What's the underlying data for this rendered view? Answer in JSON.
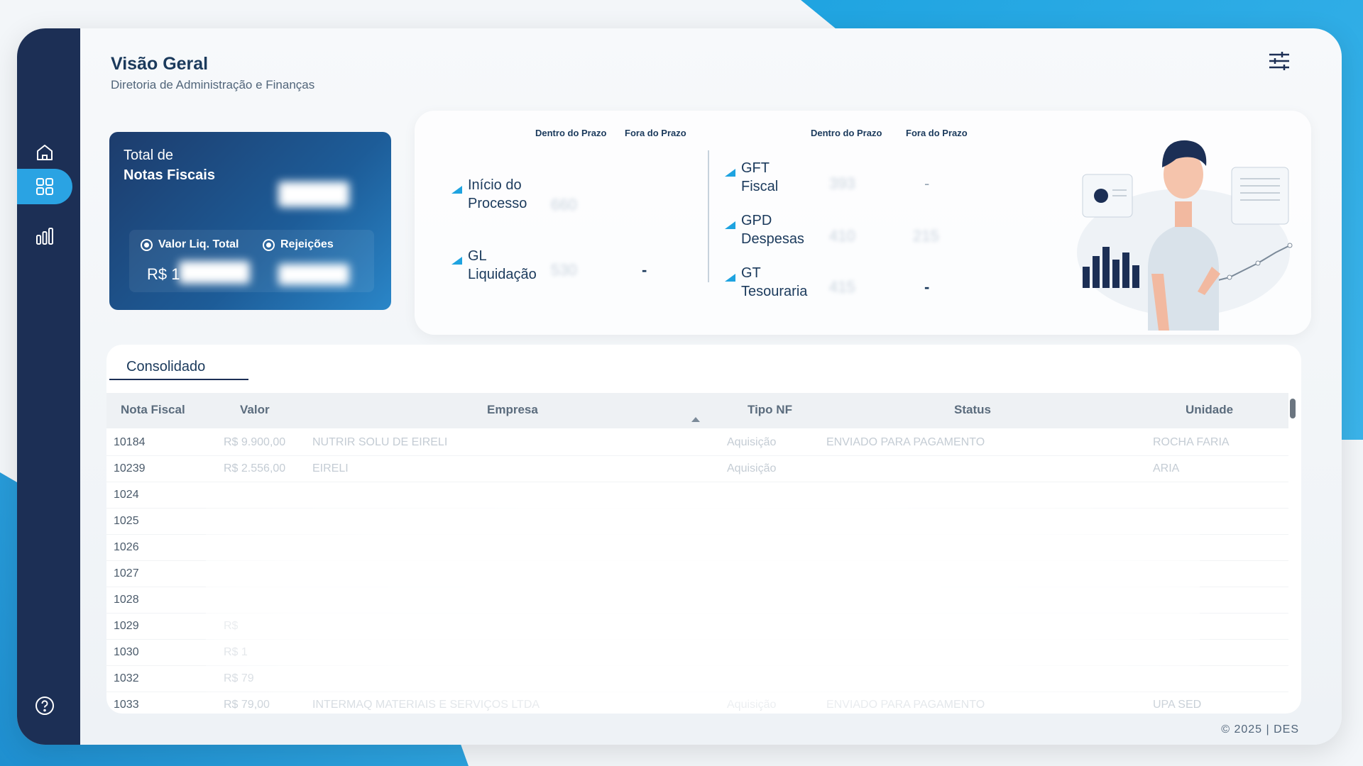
{
  "header": {
    "title": "Visão Geral",
    "subtitle": "Diretoria de Administração e Finanças"
  },
  "sidebar": {
    "items": [
      {
        "name": "home",
        "icon": "home-icon"
      },
      {
        "name": "dashboard",
        "icon": "grid-icon",
        "active": true
      },
      {
        "name": "charts",
        "icon": "bar-chart-icon"
      },
      {
        "name": "help",
        "icon": "help-icon"
      }
    ]
  },
  "kpi": {
    "label_line1": "Total de",
    "label_line2": "Notas Fiscais",
    "tab_valor": "Valor Liq. Total",
    "tab_rejeicoes": "Rejeições",
    "currency_prefix": "R$ 1"
  },
  "status": {
    "col_dentro": "Dentro do Prazo",
    "col_fora": "Fora do Prazo",
    "stages_left": [
      {
        "line1": "Início do",
        "line2": "Processo",
        "dentro": "660",
        "fora": ""
      },
      {
        "line1": "GL",
        "line2": "Liquidação",
        "dentro": "530",
        "fora": "-"
      }
    ],
    "stages_right": [
      {
        "line1": "GFT",
        "line2": "Fiscal",
        "dentro": "393",
        "fora": "-"
      },
      {
        "line1": "GPD",
        "line2": "Despesas",
        "dentro": "410",
        "fora": "215"
      },
      {
        "line1": "GT",
        "line2": "Tesouraria",
        "dentro": "415",
        "fora": "-"
      }
    ]
  },
  "table": {
    "tab_label": "Consolidado",
    "columns": [
      "Nota Fiscal",
      "Valor",
      "Empresa",
      "Tipo NF",
      "Status",
      "Unidade"
    ],
    "rows": [
      {
        "nf": "10184",
        "valor": "R$ 9.900,00",
        "empresa": "NUTRIR SOLU          DE EIRELI",
        "tipo": "Aquisição",
        "status": "ENVIADO PARA PAGAMENTO",
        "unidade": "ROCHA FARIA"
      },
      {
        "nf": "10239",
        "valor": "R$ 2.556,00",
        "empresa": "          EIRELI",
        "tipo": "Aquisição",
        "status": "",
        "unidade": "ARIA"
      },
      {
        "nf": "1024",
        "valor": "",
        "empresa": "",
        "tipo": "",
        "status": "",
        "unidade": ""
      },
      {
        "nf": "1025",
        "valor": "",
        "empresa": "",
        "tipo": "",
        "status": "",
        "unidade": ""
      },
      {
        "nf": "1026",
        "valor": "",
        "empresa": "",
        "tipo": "",
        "status": "",
        "unidade": ""
      },
      {
        "nf": "1027",
        "valor": "",
        "empresa": "",
        "tipo": "",
        "status": "",
        "unidade": ""
      },
      {
        "nf": "1028",
        "valor": "",
        "empresa": "",
        "tipo": "",
        "status": "",
        "unidade": ""
      },
      {
        "nf": "1029",
        "valor": "R$",
        "empresa": "",
        "tipo": "",
        "status": "",
        "unidade": ""
      },
      {
        "nf": "1030",
        "valor": "R$ 1",
        "empresa": "",
        "tipo": "",
        "status": "",
        "unidade": ""
      },
      {
        "nf": "1032",
        "valor": "R$ 79",
        "empresa": "",
        "tipo": "",
        "status": "",
        "unidade": ""
      },
      {
        "nf": "1033",
        "valor": "R$ 79,00",
        "empresa": "INTERMAQ MATERIAIS E SERVIÇOS LTDA",
        "tipo": "Aquisição",
        "status": "ENVIADO PARA PAGAMENTO",
        "unidade": "UPA SED"
      }
    ]
  },
  "footer": "© 2025  |  DES",
  "colors": {
    "sidebar": "#1c2f55",
    "accent": "#1ea3e0",
    "card_dark": "#1d3c6c"
  }
}
